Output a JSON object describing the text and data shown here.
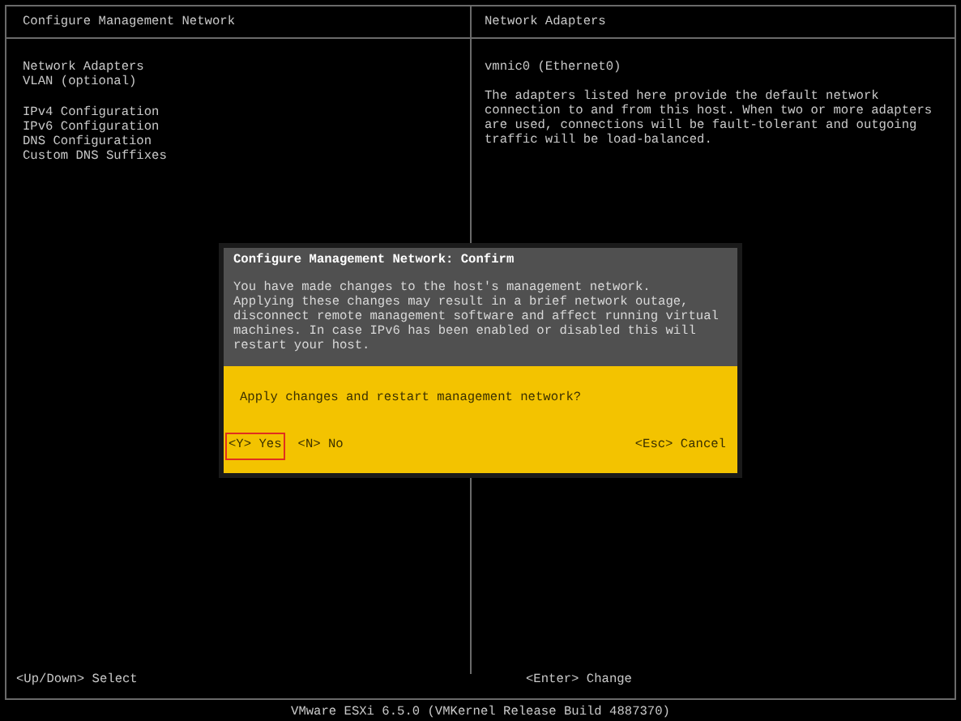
{
  "left_pane": {
    "title": "Configure Management Network",
    "groups": [
      {
        "items": [
          "Network Adapters",
          "VLAN (optional)"
        ]
      },
      {
        "items": [
          "IPv4 Configuration",
          "IPv6 Configuration",
          "DNS Configuration",
          "Custom DNS Suffixes"
        ]
      }
    ]
  },
  "right_pane": {
    "title": "Network Adapters",
    "adapter": "vmnic0 (Ethernet0)",
    "description": "The adapters listed here provide the default network connection to and from this host. When two or more adapters are used, connections will be fault-tolerant and outgoing traffic will be load-balanced."
  },
  "dialog": {
    "title": "Configure Management Network: Confirm",
    "message": "You have made changes to the host's management network.\nApplying these changes may result in a brief network outage, disconnect remote management software and affect running virtual machines. In case IPv6 has been enabled or disabled this will restart your host.",
    "question": "Apply changes and restart management network?",
    "buttons": [
      {
        "label": "<Y> Yes",
        "selected": true
      },
      {
        "label": "<N> No",
        "selected": false
      },
      {
        "label": "<Esc> Cancel",
        "selected": false
      }
    ]
  },
  "hints": {
    "left": "<Up/Down> Select",
    "right": "<Enter> Change"
  },
  "footer": "VMware ESXi 6.5.0 (VMKernel Release Build 4887370)"
}
